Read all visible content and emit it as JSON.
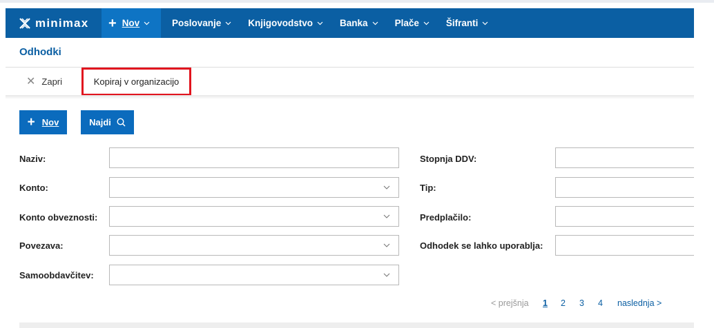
{
  "brand": {
    "name": "minimax"
  },
  "nav": {
    "new_label": "Nov",
    "items": [
      "Poslovanje",
      "Knjigovodstvo",
      "Banka",
      "Plače",
      "Šifranti"
    ]
  },
  "page_title": "Odhodki",
  "actions": {
    "close_label": "Zapri",
    "copy_label": "Kopiraj v organizacijo"
  },
  "buttons": {
    "new_label": "Nov",
    "find_label": "Najdi"
  },
  "form": {
    "naziv": {
      "label": "Naziv:",
      "value": ""
    },
    "konto": {
      "label": "Konto:",
      "value": ""
    },
    "konto_obveznosti": {
      "label": "Konto obveznosti:",
      "value": ""
    },
    "povezava": {
      "label": "Povezava:",
      "value": ""
    },
    "samoobdavcitev": {
      "label": "Samoobdavčitev:",
      "value": ""
    },
    "stopnja_ddv": {
      "label": "Stopnja DDV:",
      "value": ""
    },
    "tip": {
      "label": "Tip:",
      "value": ""
    },
    "predplacilo": {
      "label": "Predplačilo:",
      "value": ""
    },
    "uporabnost": {
      "label": "Odhodek se lahko uporablja:",
      "value": ""
    }
  },
  "pager": {
    "prev": "< prejšnja",
    "pages": [
      "1",
      "2",
      "3",
      "4"
    ],
    "current": "1",
    "next": "naslednja >"
  },
  "colors": {
    "navbar": "#0b5fa3",
    "accent": "#0e74c4",
    "highlight_border": "#e1141e"
  }
}
